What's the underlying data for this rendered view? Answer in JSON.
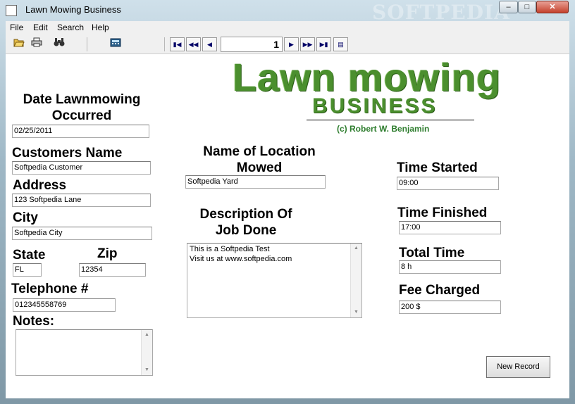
{
  "window": {
    "title": "Lawn Mowing Business",
    "watermark": "SOFTPEDIA"
  },
  "menu": [
    "File",
    "Edit",
    "Search",
    "Help"
  ],
  "toolbar": {
    "icons": [
      "open-folder-icon",
      "print-icon",
      "find-binoculars-icon",
      "calculator-icon"
    ],
    "nav_icons": [
      "first-record-icon",
      "previous-page-icon",
      "previous-record-icon",
      "next-record-icon",
      "next-page-icon",
      "last-record-icon",
      "record-properties-icon"
    ],
    "record_number": "1"
  },
  "logo": {
    "title": "Lawn mowing",
    "subtitle": "BUSINESS",
    "copyright": "(c) Robert W. Benjamin",
    "color": "#4b8f2e"
  },
  "form": {
    "date_label_line1": "Date Lawnmowing",
    "date_label_line2": "Occurred",
    "date_value": "02/25/2011",
    "customer_label": "Customers Name",
    "customer_value": "Softpedia Customer",
    "address_label": "Address",
    "address_value": "123 Softpedia Lane",
    "city_label": "City",
    "city_value": "Softpedia City",
    "state_label": "State",
    "state_value": "FL",
    "zip_label": "Zip",
    "zip_value": "12354",
    "telephone_label": "Telephone #",
    "telephone_value": "012345558769",
    "notes_label": "Notes:",
    "notes_value": "",
    "location_label_line1": "Name of Location",
    "location_label_line2": "Mowed",
    "location_value": "Softpedia Yard",
    "description_label_line1": "Description Of",
    "description_label_line2": "Job Done",
    "description_lines": [
      "This is a Softpedia Test",
      "Visit us at www.softpedia.com"
    ],
    "time_started_label": "Time Started",
    "time_started_value": "09:00",
    "time_finished_label": "Time Finished",
    "time_finished_value": "17:00",
    "total_time_label": "Total Time",
    "total_time_value": "8 h",
    "fee_label": "Fee Charged",
    "fee_value": "200 $"
  },
  "buttons": {
    "new_record": "New Record"
  }
}
